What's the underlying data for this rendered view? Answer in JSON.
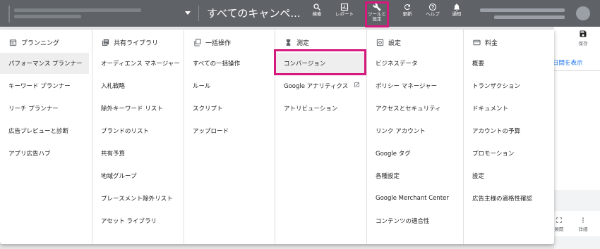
{
  "topbar": {
    "campaign_title": "すべてのキャンペ...",
    "buttons": [
      {
        "icon": "search-icon",
        "label": "検索"
      },
      {
        "icon": "reports-icon",
        "label": "レポート"
      },
      {
        "icon": "wrench-icon",
        "label": "ツールと\n設定"
      },
      {
        "icon": "refresh-icon",
        "label": "更新"
      },
      {
        "icon": "help-icon",
        "label": "ヘルプ"
      },
      {
        "icon": "bell-icon",
        "label": "通知"
      }
    ]
  },
  "background": {
    "save_label": "保存",
    "show_period_link": "日間を表示",
    "expand_label": "展開",
    "details_label": "詳細"
  },
  "menu": {
    "columns": [
      {
        "icon": "calendar-icon",
        "title": "プランニング",
        "items": [
          "パフォーマンス プランナー",
          "キーワード プランナー",
          "リーチ プランナー",
          "広告プレビューと診断",
          "アプリ広告ハブ"
        ]
      },
      {
        "icon": "library-icon",
        "title": "共有ライブラリ",
        "items": [
          "オーディエンス マネージャー",
          "入札戦略",
          "除外キーワード リスト",
          "ブランドのリスト",
          "共有予算",
          "地域グループ",
          "プレースメント除外リスト",
          "アセット ライブラリ"
        ]
      },
      {
        "icon": "copy-icon",
        "title": "一括操作",
        "items": [
          "すべての一括操作",
          "ルール",
          "スクリプト",
          "アップロード"
        ]
      },
      {
        "icon": "hourglass-icon",
        "title": "測定",
        "items": [
          "コンバージョン",
          "Google アナリティクス",
          "アトリビューション"
        ]
      },
      {
        "icon": "settings-box-icon",
        "title": "設定",
        "items": [
          "ビジネスデータ",
          "ポリシー マネージャー",
          "アクセスとセキュリティ",
          "リンク アカウント",
          "Google タグ",
          "各種設定",
          "Google Merchant Center",
          "コンテンツの適合性"
        ]
      },
      {
        "icon": "credit-card-icon",
        "title": "料金",
        "items": [
          "概要",
          "トランザクション",
          "ドキュメント",
          "アカウントの予算",
          "プロモーション",
          "設定",
          "広告主様の適格性確認"
        ]
      }
    ]
  }
}
